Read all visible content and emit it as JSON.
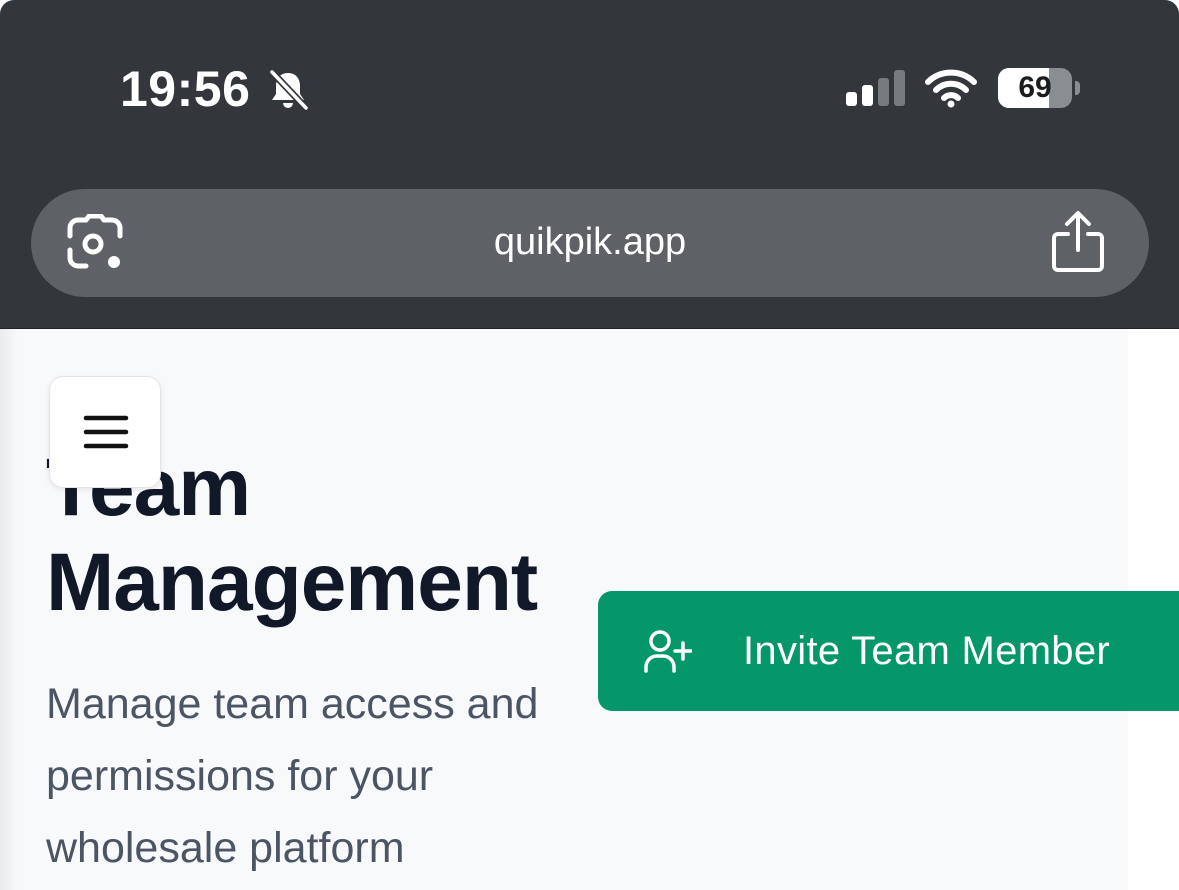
{
  "status_bar": {
    "time": "19:56",
    "battery_level": "69",
    "battery_fraction": 0.69,
    "icons": [
      "bell-slash-icon",
      "cellular-signal-icon",
      "wifi-icon",
      "battery-icon"
    ]
  },
  "browser": {
    "url": "quikpik.app",
    "left_icon": "camera-lens-icon",
    "right_icon": "share-icon"
  },
  "page": {
    "menu_icon": "hamburger-menu-icon",
    "title": "Team Management",
    "subtitle": "Manage team access and permissions for your wholesale platform",
    "invite_button": {
      "label": "Invite Team Member",
      "icon": "user-plus-icon",
      "color": "#05966a"
    }
  },
  "colors": {
    "chrome_background": "#33363a",
    "url_bar": "#5e6266",
    "page_background": "#f8f9fb",
    "title_text": "#111827",
    "subtitle_text": "#4b5563",
    "accent_green": "#05966a"
  }
}
